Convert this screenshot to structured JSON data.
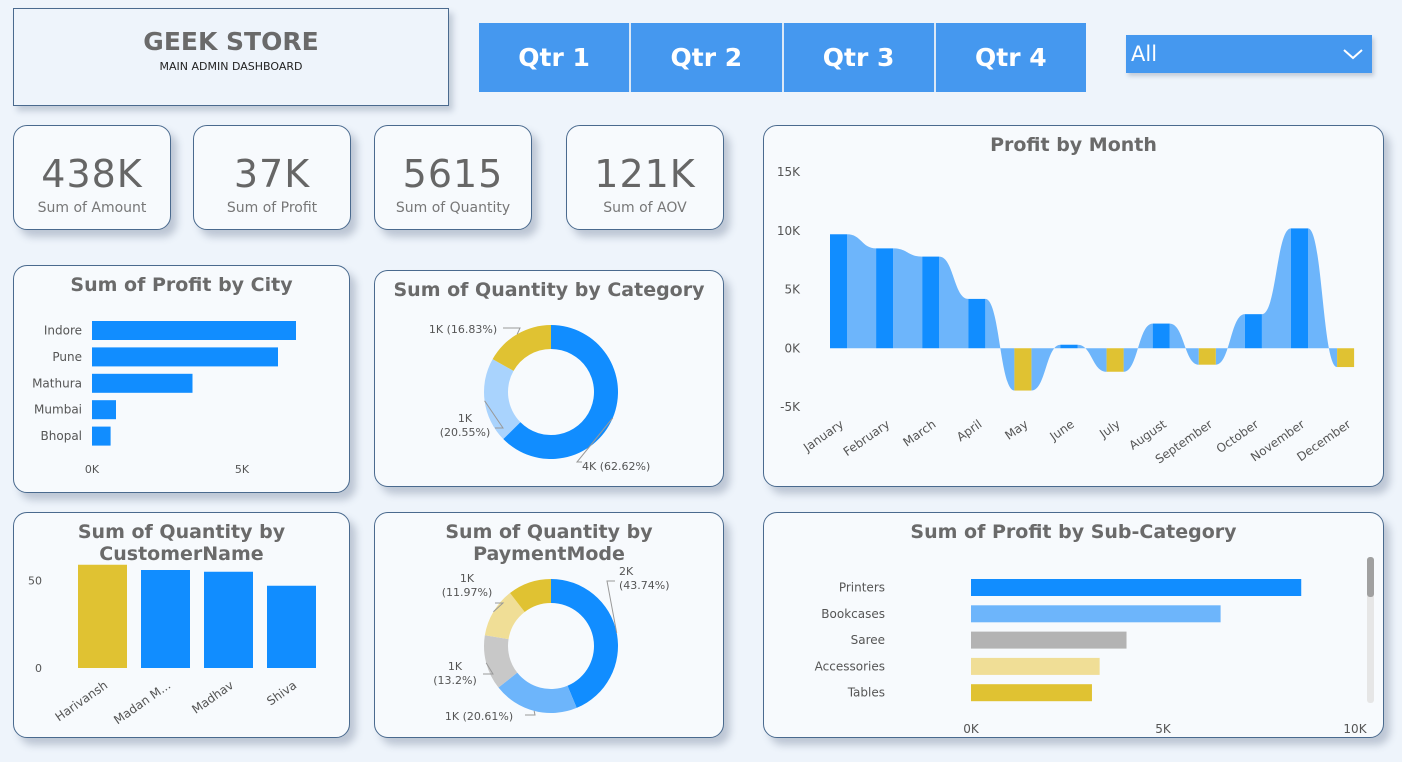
{
  "header": {
    "title": "GEEK STORE",
    "subtitle": "MAIN ADMIN DASHBOARD"
  },
  "quarters": [
    "Qtr 1",
    "Qtr 2",
    "Qtr 3",
    "Qtr 4"
  ],
  "filter": {
    "selected": "All"
  },
  "kpis": [
    {
      "value": "438K",
      "label": "Sum of Amount"
    },
    {
      "value": "37K",
      "label": "Sum of Profit"
    },
    {
      "value": "5615",
      "label": "Sum of Quantity"
    },
    {
      "value": "121K",
      "label": "Sum of AOV"
    }
  ],
  "colors": {
    "accent": "#4598ef",
    "blue": "#118dff",
    "lightblue": "#6db5fb",
    "gold": "#e0c232",
    "gray": "#b3b3b3",
    "palegold": "#f0de96",
    "paleblue": "#a9d3fd"
  },
  "chart_data": [
    {
      "id": "city",
      "type": "bar",
      "orientation": "horizontal",
      "title": "Sum of Profit by City",
      "categories": [
        "Indore",
        "Pune",
        "Mathura",
        "Mumbai",
        "Bhopal"
      ],
      "values": [
        6800,
        6200,
        3350,
        800,
        620
      ],
      "xticks": [
        "0K",
        "5K"
      ],
      "xlim": [
        0,
        6800
      ]
    },
    {
      "id": "category",
      "type": "pie",
      "donut": true,
      "title": "Sum of Quantity by Category",
      "slices": [
        {
          "label": "4K (62.62%)",
          "value": 62.62,
          "color": "#118dff"
        },
        {
          "label": "1K\n(20.55%)",
          "value": 20.55,
          "color": "#a9d3fd"
        },
        {
          "label": "1K (16.83%)",
          "value": 16.83,
          "color": "#e0c232"
        }
      ]
    },
    {
      "id": "month",
      "type": "area",
      "title": "Profit by Month",
      "categories": [
        "January",
        "February",
        "March",
        "April",
        "May",
        "June",
        "July",
        "August",
        "September",
        "October",
        "November",
        "December"
      ],
      "values": [
        9700,
        8500,
        7800,
        4200,
        -3600,
        300,
        -2000,
        2100,
        -1400,
        2900,
        10200,
        -1600
      ],
      "yticks": [
        "15K",
        "10K",
        "5K",
        "0K",
        "-5K"
      ],
      "ylim": [
        -5000,
        15000
      ]
    },
    {
      "id": "customer",
      "type": "bar",
      "title": "Sum of Quantity by CustomerName",
      "categories": [
        "Harivansh",
        "Madan M...",
        "Madhav",
        "Shiva"
      ],
      "values": [
        59,
        56,
        55,
        47
      ],
      "colors": [
        "#e0c232",
        "#118dff",
        "#118dff",
        "#118dff"
      ],
      "yticks": [
        "50",
        "0"
      ],
      "ylim": [
        0,
        60
      ]
    },
    {
      "id": "payment",
      "type": "pie",
      "donut": true,
      "title": "Sum of Quantity by PaymentMode",
      "slices": [
        {
          "label": "2K\n(43.74%)",
          "value": 43.74,
          "color": "#118dff"
        },
        {
          "label": "1K (20.61%)",
          "value": 20.61,
          "color": "#6db5fb"
        },
        {
          "label": "1K\n(13.2%)",
          "value": 13.2,
          "color": "#c8c8c8"
        },
        {
          "label": "1K\n(11.97%)",
          "value": 11.97,
          "color": "#f0de96"
        },
        {
          "label": "",
          "value": 10.48,
          "color": "#e0c232"
        }
      ]
    },
    {
      "id": "subcat",
      "type": "bar",
      "orientation": "horizontal",
      "title": "Sum of Profit by Sub-Category",
      "categories": [
        "Printers",
        "Bookcases",
        "Saree",
        "Accessories",
        "Tables"
      ],
      "values": [
        8600,
        6500,
        4050,
        3350,
        3150
      ],
      "colors": [
        "#118dff",
        "#6db5fb",
        "#b3b3b3",
        "#f0de96",
        "#e0c232"
      ],
      "xticks": [
        "0K",
        "5K",
        "10K"
      ],
      "xlim": [
        0,
        10000
      ]
    }
  ]
}
